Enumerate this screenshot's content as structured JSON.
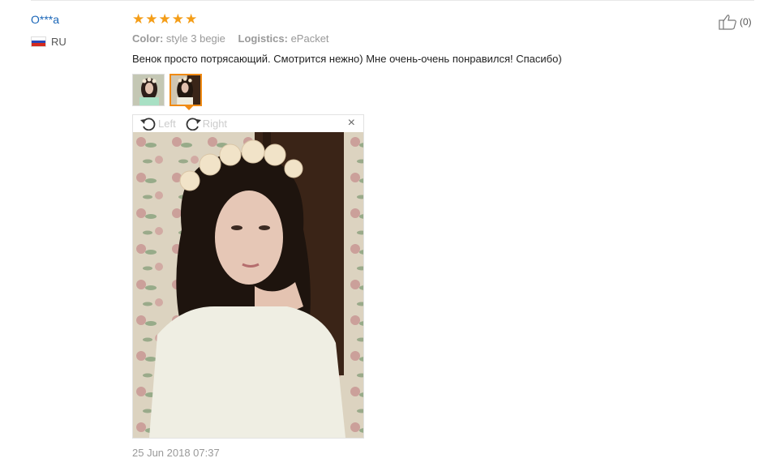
{
  "review": {
    "reviewer": "O***a",
    "country": "RU",
    "rating": 5,
    "color_label": "Color:",
    "color_value": "style 3 begie",
    "logistics_label": "Logistics:",
    "logistics_value": "ePacket",
    "text": "Венок просто потрясающий. Смотрится нежно) Мне очень-очень понравился! Спасибо)",
    "date": "25 Jun 2018 07:37",
    "helpful_count": "(0)"
  },
  "viewer": {
    "rotate_left": "Left",
    "rotate_right": "Right",
    "close": "×"
  },
  "colors": {
    "link": "#1a66b8",
    "star": "#f49d17",
    "active_thumb": "#f08a14"
  }
}
